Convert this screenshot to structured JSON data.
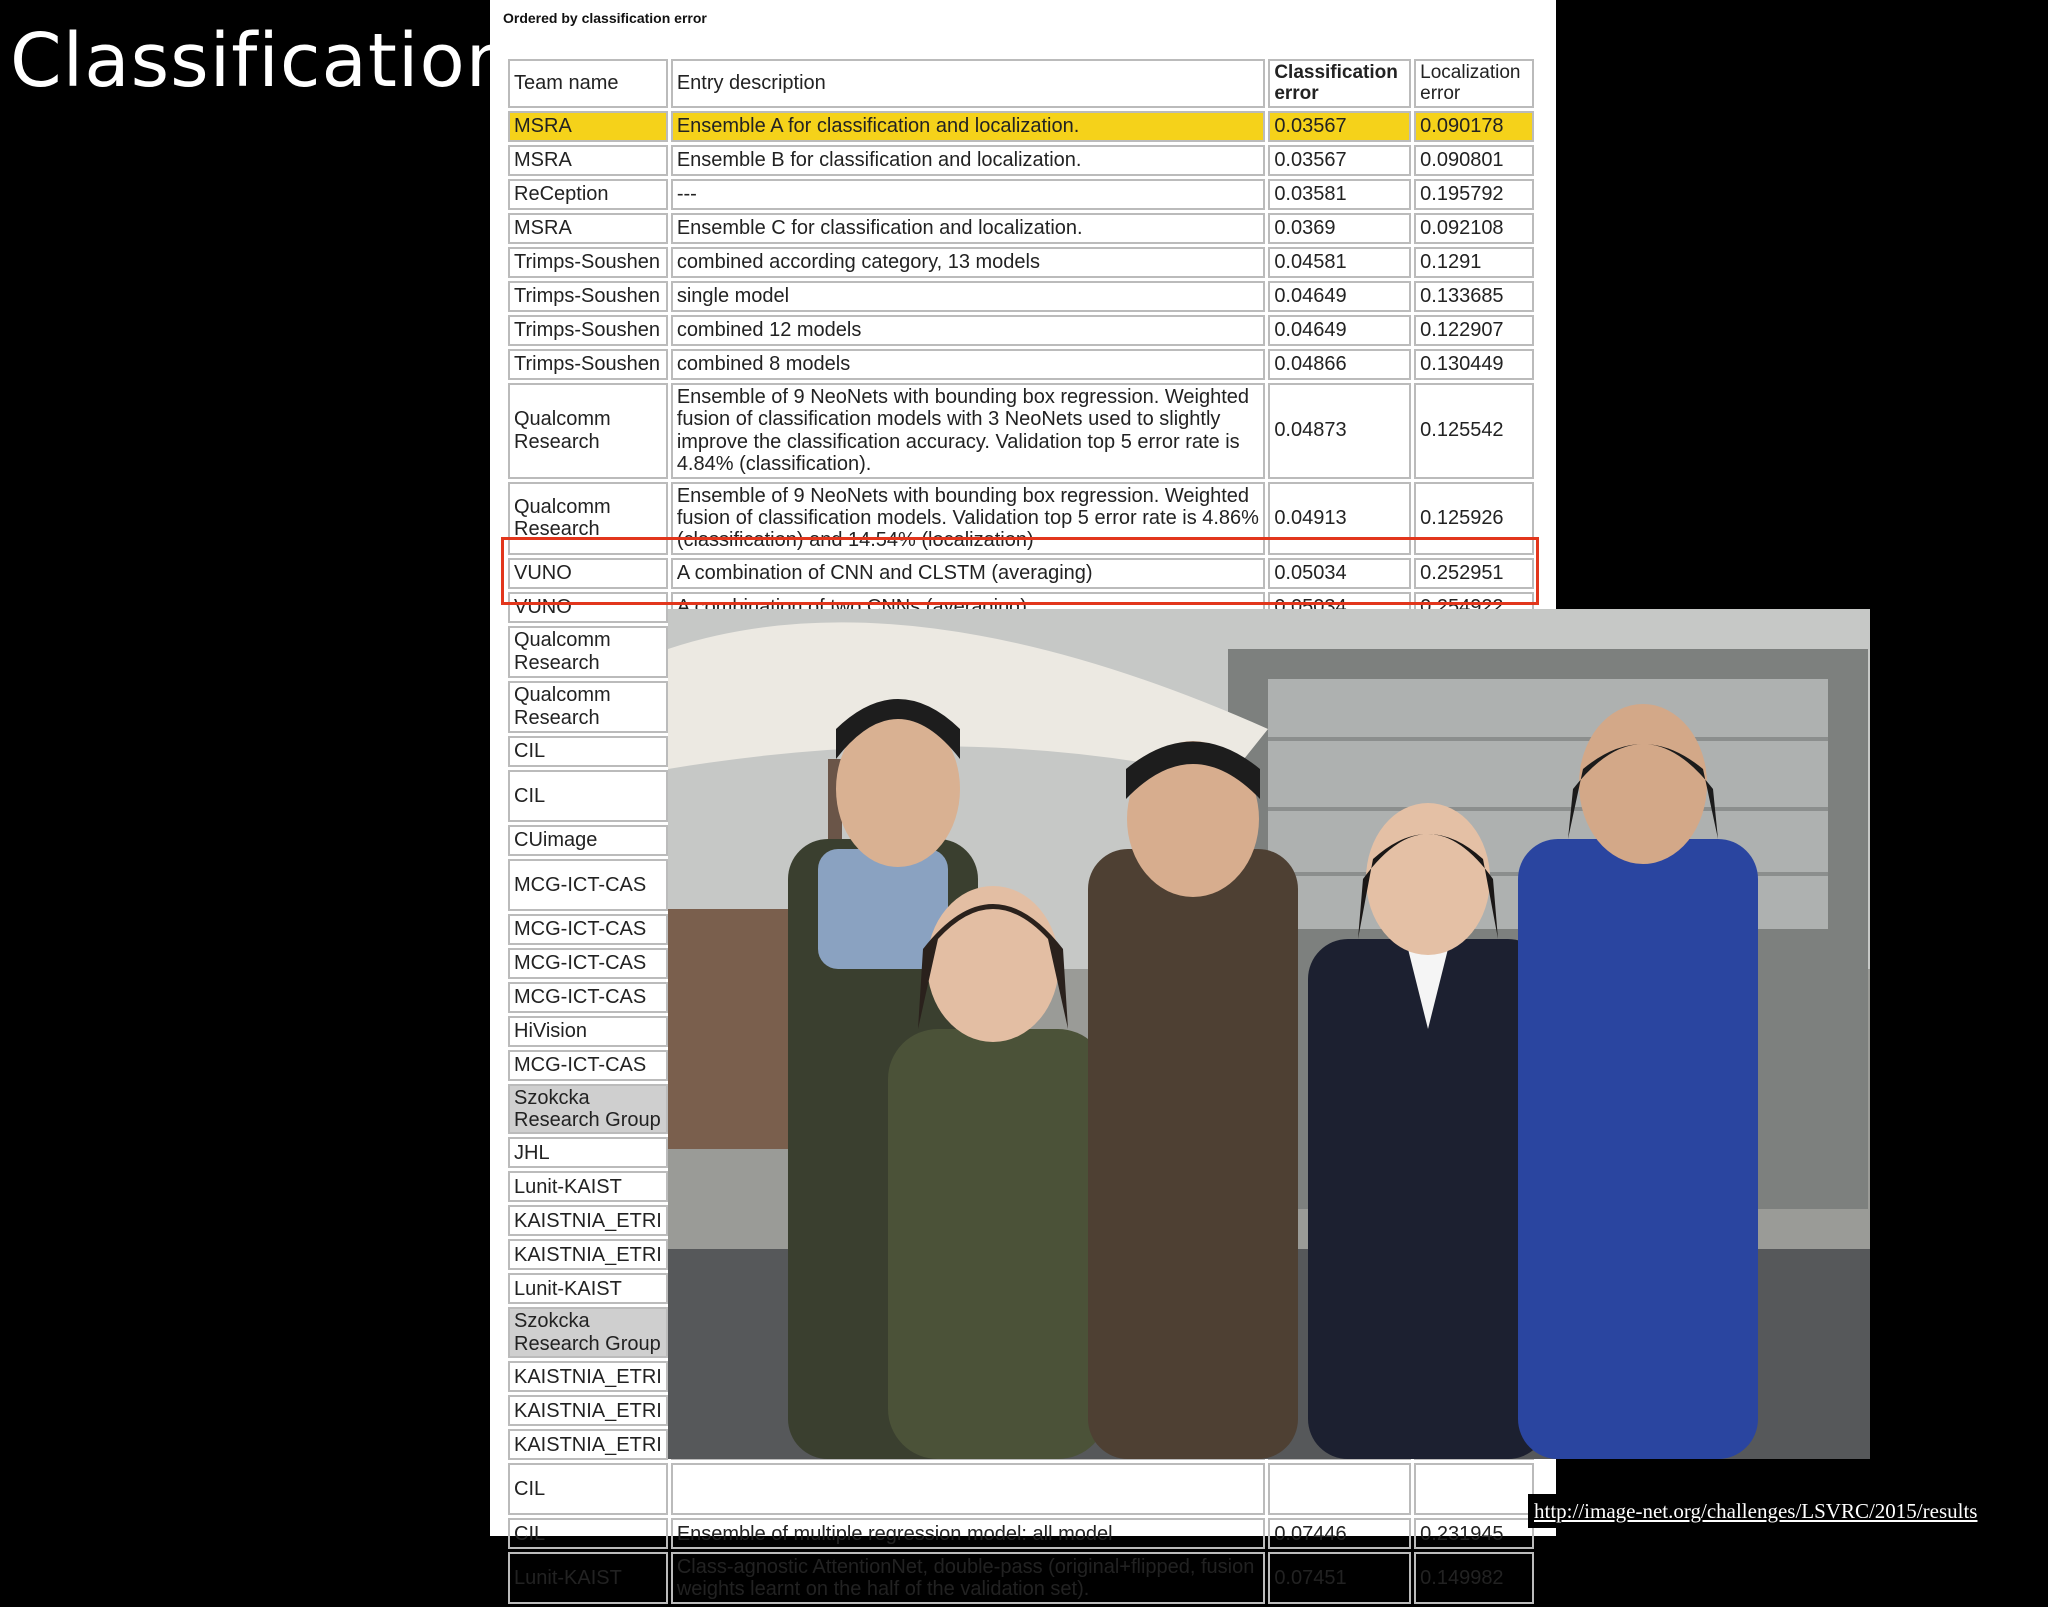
{
  "slide": {
    "title": "Classification",
    "url": "http://image-net.org/challenges/LSVRC/2015/results"
  },
  "table": {
    "caption": "Ordered by classification error",
    "headers": {
      "team": "Team name",
      "desc": "Entry description",
      "cls": "Classification error",
      "loc": "Localization error"
    },
    "rows": [
      {
        "team": "MSRA",
        "desc": "Ensemble A for classification and localization.",
        "cls": "0.03567",
        "loc": "0.090178",
        "highlight": true
      },
      {
        "team": "MSRA",
        "desc": "Ensemble B for classification and localization.",
        "cls": "0.03567",
        "loc": "0.090801"
      },
      {
        "team": "ReCeption",
        "desc": "---",
        "cls": "0.03581",
        "loc": "0.195792"
      },
      {
        "team": "MSRA",
        "desc": "Ensemble C for classification and localization.",
        "cls": "0.0369",
        "loc": "0.092108"
      },
      {
        "team": "Trimps-Soushen",
        "desc": "combined according category, 13 models",
        "cls": "0.04581",
        "loc": "0.1291"
      },
      {
        "team": "Trimps-Soushen",
        "desc": "single model",
        "cls": "0.04649",
        "loc": "0.133685"
      },
      {
        "team": "Trimps-Soushen",
        "desc": "combined 12 models",
        "cls": "0.04649",
        "loc": "0.122907"
      },
      {
        "team": "Trimps-Soushen",
        "desc": "combined 8 models",
        "cls": "0.04866",
        "loc": "0.130449"
      },
      {
        "team": "Qualcomm Research",
        "desc": "Ensemble of 9 NeoNets with bounding box regression. Weighted fusion of classification models with 3 NeoNets used to slightly improve the classification accuracy. Validation top 5 error rate is 4.84% (classification).",
        "cls": "0.04873",
        "loc": "0.125542"
      },
      {
        "team": "Qualcomm Research",
        "desc": "Ensemble of 9 NeoNets with bounding box regression. Weighted fusion of classification models. Validation top 5 error rate is 4.86% (classification) and 14.54% (localization)",
        "cls": "0.04913",
        "loc": "0.125926"
      },
      {
        "team": "VUNO",
        "desc": "A combination of CNN and CLSTM (averaging)",
        "cls": "0.05034",
        "loc": "0.252951",
        "boxed": true
      },
      {
        "team": "VUNO",
        "desc": "A combination of two CNNs (averaging)",
        "cls": "0.05034",
        "loc": "0.254922",
        "boxed": true
      },
      {
        "team": "Qualcomm Research",
        "desc": "",
        "cls": "",
        "loc": ""
      },
      {
        "team": "Qualcomm Research",
        "desc": "",
        "cls": "",
        "loc": ""
      },
      {
        "team": "CIL",
        "desc": "",
        "cls": "",
        "loc": ""
      },
      {
        "team": "CIL",
        "desc": "",
        "cls": "",
        "loc": "",
        "tall": true
      },
      {
        "team": "CUimage",
        "desc": "",
        "cls": "",
        "loc": ""
      },
      {
        "team": "MCG-ICT-CAS",
        "desc": "",
        "cls": "",
        "loc": "",
        "tall": true
      },
      {
        "team": "MCG-ICT-CAS",
        "desc": "",
        "cls": "",
        "loc": ""
      },
      {
        "team": "MCG-ICT-CAS",
        "desc": "",
        "cls": "",
        "loc": ""
      },
      {
        "team": "MCG-ICT-CAS",
        "desc": "",
        "cls": "",
        "loc": ""
      },
      {
        "team": "HiVision",
        "desc": "",
        "cls": "",
        "loc": ""
      },
      {
        "team": "MCG-ICT-CAS",
        "desc": "",
        "cls": "",
        "loc": ""
      },
      {
        "team": "Szokcka Research Group",
        "desc": "",
        "cls": "",
        "loc": "",
        "grey": true
      },
      {
        "team": "JHL",
        "desc": "",
        "cls": "",
        "loc": ""
      },
      {
        "team": "Lunit-KAIST",
        "desc": "",
        "cls": "",
        "loc": ""
      },
      {
        "team": "KAISTNIA_ETRI",
        "desc": "",
        "cls": "",
        "loc": ""
      },
      {
        "team": "KAISTNIA_ETRI",
        "desc": "",
        "cls": "",
        "loc": ""
      },
      {
        "team": "Lunit-KAIST",
        "desc": "",
        "cls": "",
        "loc": ""
      },
      {
        "team": "Szokcka Research Group",
        "desc": "",
        "cls": "",
        "loc": "",
        "grey": true
      },
      {
        "team": "KAISTNIA_ETRI",
        "desc": "",
        "cls": "",
        "loc": ""
      },
      {
        "team": "KAISTNIA_ETRI",
        "desc": "",
        "cls": "",
        "loc": ""
      },
      {
        "team": "KAISTNIA_ETRI",
        "desc": "",
        "cls": "",
        "loc": ""
      },
      {
        "team": "CIL",
        "desc": "",
        "cls": "",
        "loc": "",
        "tall": true
      },
      {
        "team": "CIL",
        "desc": "Ensemble of multiple regression model: all model",
        "cls": "0.07446",
        "loc": "0.231945"
      },
      {
        "team": "Lunit-KAIST",
        "desc": "Class-agnostic AttentionNet, double-pass (original+flipped, fusion weights learnt on the half of the validation set).",
        "cls": "0.07451",
        "loc": "0.149982"
      }
    ]
  },
  "photo": {
    "subject": "team-photo"
  }
}
